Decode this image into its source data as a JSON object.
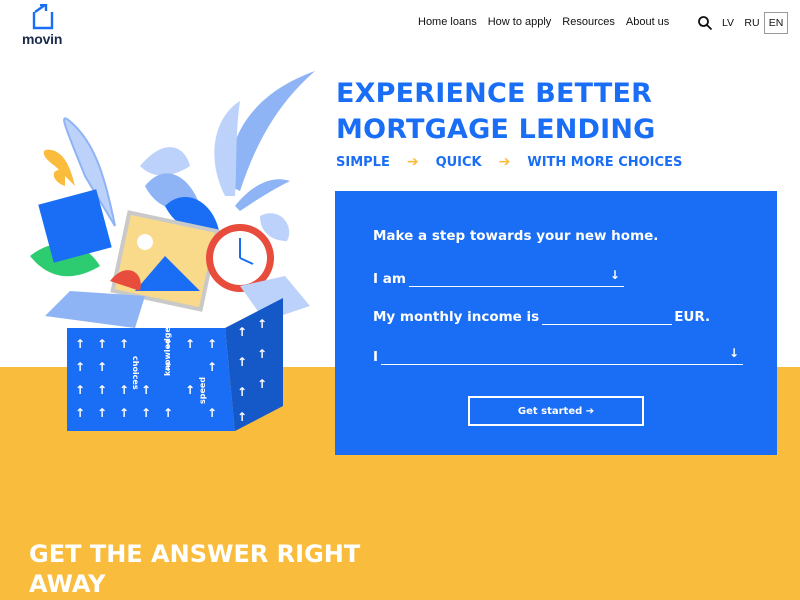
{
  "brand": {
    "name": "movin"
  },
  "nav": {
    "items": [
      {
        "label": "Home loans"
      },
      {
        "label": "How to apply"
      },
      {
        "label": "Resources"
      },
      {
        "label": "About us"
      }
    ]
  },
  "languages": [
    {
      "code": "LV",
      "active": false
    },
    {
      "code": "RU",
      "active": false
    },
    {
      "code": "EN",
      "active": true
    }
  ],
  "icons": {
    "search": "search-icon",
    "logo": "logo-house-arrow-icon"
  },
  "hero": {
    "headline_line1": "EXPERIENCE BETTER",
    "headline_line2": "MORTGAGE LENDING",
    "steps": [
      "SIMPLE",
      "QUICK",
      "WITH MORE CHOICES"
    ],
    "step_arrow": "➔"
  },
  "form": {
    "title": "Make a step towards your new home.",
    "row1_label": "I am",
    "row1_value": "",
    "row2_label": "My monthly income is",
    "row2_value": "",
    "row2_suffix": "EUR.",
    "row3_label": "I",
    "row3_value": "",
    "cta_label": "Get started ➔"
  },
  "illustration_box_words": [
    "choices",
    "knowledge",
    "speed"
  ],
  "section2": {
    "title_line1": "GET THE ANSWER RIGHT",
    "title_line2": "AWAY"
  },
  "colors": {
    "blue": "#1a6ef5",
    "yellow": "#f9bc3c",
    "dark": "#1a2b4a"
  }
}
